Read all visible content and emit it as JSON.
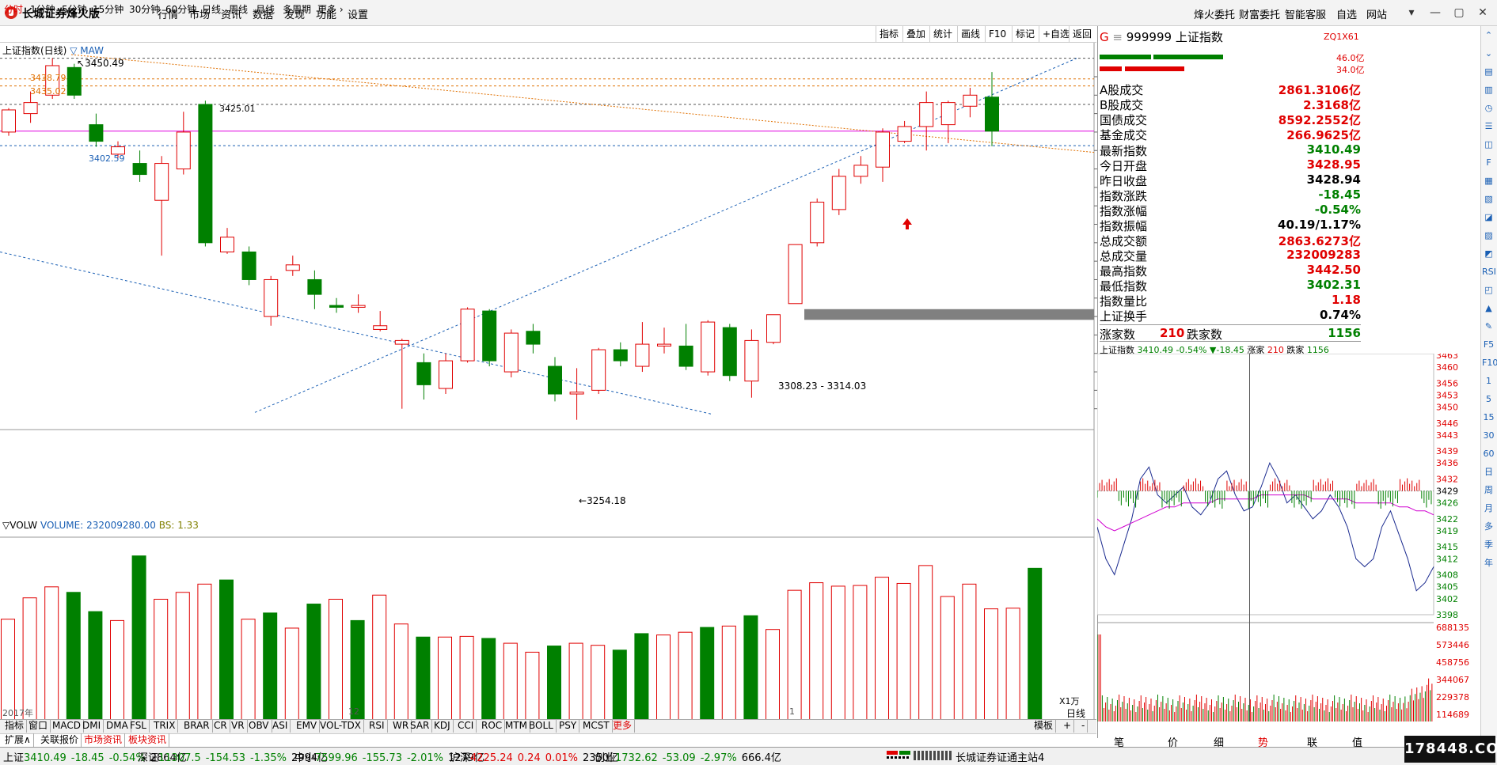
{
  "app": {
    "title": "长城证券烽火版"
  },
  "menu": [
    "行情",
    "市场",
    "资讯",
    "数据",
    "发现",
    "功能",
    "设置"
  ],
  "right_menu": [
    "烽火委托",
    "财富委托",
    "智能客服",
    "自选",
    "网站"
  ],
  "window_controls": [
    "▾",
    "—",
    "▢",
    "✕"
  ],
  "periods": [
    "分时",
    "1分钟",
    "5分钟",
    "15分钟",
    "30分钟",
    "60分钟",
    "日线",
    "周线",
    "月线",
    "多周期",
    "更多"
  ],
  "chart_tools": [
    "指标",
    "叠加",
    "统计",
    "画线",
    "F10",
    "标记",
    "+自选",
    "返回"
  ],
  "main_chart": {
    "title": "上证指数(日线)",
    "indicator": "▽ MAW",
    "y_ticks": [
      3440,
      3430,
      3420,
      3410,
      3400,
      3390,
      3380,
      3370,
      3360,
      3350,
      3340,
      3330,
      3320,
      3310,
      3300,
      3290,
      3280,
      3270,
      3260
    ],
    "annotations": {
      "high": "3450.49",
      "low": "3254.18",
      "a1": "3425.01",
      "a2": "3438.79",
      "a3": "3435.02",
      "a4": "3402.59",
      "gap": "3308.23 - 3314.03"
    },
    "x_labels": [
      "2017年",
      "12",
      "1"
    ]
  },
  "chart_data": [
    {
      "type": "candlestick",
      "title": "上证指数(日线)",
      "y_range": [
        3250,
        3455
      ],
      "candles": [
        {
          "o": 3410,
          "c": 3422,
          "h": 3423,
          "l": 3408
        },
        {
          "o": 3420,
          "c": 3426,
          "h": 3432,
          "l": 3415
        },
        {
          "o": 3430,
          "c": 3446,
          "h": 3450,
          "l": 3428
        },
        {
          "o": 3445,
          "c": 3430,
          "h": 3447,
          "l": 3428
        },
        {
          "o": 3414,
          "c": 3405,
          "h": 3420,
          "l": 3402
        },
        {
          "o": 3398,
          "c": 3402,
          "h": 3405,
          "l": 3396
        },
        {
          "o": 3393,
          "c": 3387,
          "h": 3400,
          "l": 3383
        },
        {
          "o": 3373,
          "c": 3393,
          "h": 3397,
          "l": 3343
        },
        {
          "o": 3390,
          "c": 3410,
          "h": 3421,
          "l": 3387
        },
        {
          "o": 3425,
          "c": 3350,
          "h": 3427,
          "l": 3348
        },
        {
          "o": 3345,
          "c": 3353,
          "h": 3358,
          "l": 3344
        },
        {
          "o": 3345,
          "c": 3330,
          "h": 3348,
          "l": 3327
        },
        {
          "o": 3310,
          "c": 3330,
          "h": 3332,
          "l": 3305
        },
        {
          "o": 3335,
          "c": 3338,
          "h": 3343,
          "l": 3332
        },
        {
          "o": 3330,
          "c": 3322,
          "h": 3335,
          "l": 3314
        },
        {
          "o": 3316,
          "c": 3315,
          "h": 3320,
          "l": 3312
        },
        {
          "o": 3315,
          "c": 3316,
          "h": 3322,
          "l": 3312
        },
        {
          "o": 3303,
          "c": 3305,
          "h": 3313,
          "l": 3302
        },
        {
          "o": 3295,
          "c": 3297,
          "h": 3298,
          "l": 3260
        },
        {
          "o": 3285,
          "c": 3273,
          "h": 3290,
          "l": 3265
        },
        {
          "o": 3271,
          "c": 3286,
          "h": 3290,
          "l": 3268
        },
        {
          "o": 3286,
          "c": 3314,
          "h": 3315,
          "l": 3285
        },
        {
          "o": 3313,
          "c": 3286,
          "h": 3314,
          "l": 3283
        },
        {
          "o": 3280,
          "c": 3301,
          "h": 3303,
          "l": 3277
        },
        {
          "o": 3302,
          "c": 3295,
          "h": 3306,
          "l": 3290
        },
        {
          "o": 3283,
          "c": 3268,
          "h": 3288,
          "l": 3264
        },
        {
          "o": 3268,
          "c": 3269,
          "h": 3282,
          "l": 3254
        },
        {
          "o": 3270,
          "c": 3292,
          "h": 3293,
          "l": 3268
        },
        {
          "o": 3292,
          "c": 3286,
          "h": 3296,
          "l": 3283
        },
        {
          "o": 3283,
          "c": 3295,
          "h": 3307,
          "l": 3280
        },
        {
          "o": 3294,
          "c": 3295,
          "h": 3304,
          "l": 3290
        },
        {
          "o": 3294,
          "c": 3283,
          "h": 3306,
          "l": 3281
        },
        {
          "o": 3280,
          "c": 3307,
          "h": 3308,
          "l": 3278
        },
        {
          "o": 3304,
          "c": 3278,
          "h": 3306,
          "l": 3275
        },
        {
          "o": 3275,
          "c": 3297,
          "h": 3303,
          "l": 3266
        },
        {
          "o": 3296,
          "c": 3311,
          "h": 3311,
          "l": 3295
        },
        {
          "o": 3317,
          "c": 3349,
          "h": 3349,
          "l": 3317
        },
        {
          "o": 3350,
          "c": 3372,
          "h": 3374,
          "l": 3348
        },
        {
          "o": 3368,
          "c": 3386,
          "h": 3390,
          "l": 3365
        },
        {
          "o": 3386,
          "c": 3392,
          "h": 3397,
          "l": 3382
        },
        {
          "o": 3391,
          "c": 3410,
          "h": 3412,
          "l": 3383
        },
        {
          "o": 3405,
          "c": 3413,
          "h": 3416,
          "l": 3404
        },
        {
          "o": 3413,
          "c": 3426,
          "h": 3432,
          "l": 3400
        },
        {
          "o": 3414,
          "c": 3426,
          "h": 3427,
          "l": 3404
        },
        {
          "o": 3424,
          "c": 3430,
          "h": 3434,
          "l": 3418
        },
        {
          "o": 3428.95,
          "c": 3410.49,
          "h": 3442.5,
          "l": 3402.31
        }
      ]
    },
    {
      "type": "bar",
      "title": "VOLUME",
      "y_ticks": [
        25000,
        20000,
        15000,
        10000,
        5000
      ],
      "y_range": [
        0,
        26000
      ],
      "values": [
        15800,
        18900,
        20500,
        19700,
        16900,
        15600,
        25000,
        18700,
        19700,
        20900,
        21500,
        15800,
        16700,
        14500,
        18000,
        18700,
        15600,
        19300,
        15100,
        13200,
        13200,
        13300,
        13000,
        12300,
        11000,
        11900,
        12300,
        12000,
        11300,
        13700,
        13500,
        13900,
        14600,
        14800,
        16300,
        14300,
        20000,
        21100,
        20600,
        20700,
        21900,
        21000,
        23600,
        19100,
        20900,
        17300,
        17400,
        23200
      ],
      "up": [
        1,
        1,
        1,
        0,
        0,
        1,
        0,
        1,
        1,
        1,
        0,
        1,
        0,
        1,
        0,
        1,
        0,
        1,
        1,
        0,
        1,
        1,
        0,
        1,
        1,
        0,
        1,
        1,
        0,
        0,
        1,
        1,
        0,
        1,
        0,
        1,
        1,
        1,
        1,
        1,
        1,
        1,
        1,
        1,
        1,
        1,
        1,
        0
      ]
    },
    {
      "type": "line",
      "title": "上证指数 分时",
      "y_ticks": [
        3463,
        3460,
        3456,
        3453,
        3450,
        3446,
        3443,
        3439,
        3436,
        3432,
        3429,
        3426,
        3422,
        3419,
        3415,
        3412,
        3408,
        3405,
        3402,
        3398
      ],
      "vol_ticks": [
        688135,
        573446,
        458756,
        344067,
        229378,
        114689
      ]
    }
  ],
  "volume_panel": {
    "header": "▽VOLW",
    "label": "VOLUME:",
    "value": "232009280.00",
    "bs": "BS: 1.33",
    "unit": "X1万"
  },
  "stock": {
    "code": "999999",
    "name": "上证指数",
    "badge_g": "G",
    "tag": "ZQ1X61",
    "v1": "46.0亿",
    "v2": "34.0亿"
  },
  "quote_a": [
    {
      "label": "A股成交",
      "value": "2861.3106亿",
      "cls": "red"
    },
    {
      "label": "B股成交",
      "value": "2.3168亿",
      "cls": "red"
    },
    {
      "label": "国债成交",
      "value": "8592.2552亿",
      "cls": "red"
    },
    {
      "label": "基金成交",
      "value": "266.9625亿",
      "cls": "red"
    }
  ],
  "quote_b": [
    {
      "label": "最新指数",
      "value": "3410.49",
      "cls": "green"
    },
    {
      "label": "今日开盘",
      "value": "3428.95",
      "cls": "red"
    },
    {
      "label": "昨日收盘",
      "value": "3428.94",
      "cls": "blk"
    },
    {
      "label": "指数涨跌",
      "value": "-18.45",
      "cls": "green"
    },
    {
      "label": "指数涨幅",
      "value": "-0.54%",
      "cls": "green"
    },
    {
      "label": "指数振幅",
      "value": "40.19/1.17%",
      "cls": "blk"
    },
    {
      "label": "总成交额",
      "value": "2863.6273亿",
      "cls": "red"
    },
    {
      "label": "总成交量",
      "value": "232009283",
      "cls": "red"
    },
    {
      "label": "最高指数",
      "value": "3442.50",
      "cls": "red"
    },
    {
      "label": "最低指数",
      "value": "3402.31",
      "cls": "green"
    },
    {
      "label": "指数量比",
      "value": "1.18",
      "cls": "red"
    },
    {
      "label": "上证换手",
      "value": "0.74%",
      "cls": "blk"
    }
  ],
  "breadth": {
    "up_label": "涨家数",
    "up": "210",
    "down_label": "跌家数",
    "down": "1156"
  },
  "mini": {
    "title": "上证指数",
    "price": "3410.49",
    "pct": "-0.54%",
    "chg": "▼-18.45",
    "up_l": "涨家",
    "up": "210",
    "dn_l": "跌家",
    "dn": "1156"
  },
  "right_tabs": [
    "笔",
    "价",
    "细",
    "势",
    "联",
    "值"
  ],
  "indicator_tabs": [
    "指标",
    "窗口",
    "MACD",
    "DMI",
    "DMA",
    "FSL",
    "TRIX",
    "BRAR",
    "CR",
    "VR",
    "OBV",
    "ASI",
    "EMV",
    "VOL-TDX",
    "RSI",
    "WR",
    "SAR",
    "KDJ",
    "CCI",
    "ROC",
    "MTM",
    "BOLL",
    "PSY",
    "MCST",
    "更多"
  ],
  "template_tabs": [
    "模板",
    "+",
    "-"
  ],
  "extra_tabs": [
    "扩展∧",
    "关联报价",
    "市场资讯",
    "板块资讯"
  ],
  "side_icons": [
    "⌃",
    "⌄",
    "▤",
    "▥",
    "◷",
    "☰",
    "◫",
    "F",
    "▦",
    "▧",
    "◪",
    "▨",
    "◩",
    "RSI",
    "◰",
    "▲",
    "✎",
    "F5",
    "F10",
    "1",
    "5",
    "15",
    "30",
    "60",
    "日",
    "周",
    "月",
    "多",
    "季",
    "年"
  ],
  "status": [
    {
      "name": "上证",
      "price": "3410.49",
      "chg": "-18.45",
      "pct": "-0.54%",
      "amt": "2864亿"
    },
    {
      "name": "深证",
      "price": "11307.5",
      "chg": "-154.53",
      "pct": "-1.35%",
      "amt": "2994亿"
    },
    {
      "name": "中小",
      "price": "7599.96",
      "chg": "-155.73",
      "pct": "-2.01%",
      "amt": "1279亿"
    },
    {
      "name": "沪深",
      "price": "4225.24",
      "chg": "0.24",
      "pct": "0.01%",
      "amt": "2350亿"
    },
    {
      "name": "创业",
      "price": "1732.62",
      "chg": "-53.09",
      "pct": "-2.97%",
      "amt": "666.4亿"
    }
  ],
  "server": "长城证券证通主站4",
  "watermark": "178448.COM",
  "colors": {
    "up": "#e00000",
    "down": "#008000",
    "bg": "#ffffff",
    "accent": "#1a5fb4"
  }
}
